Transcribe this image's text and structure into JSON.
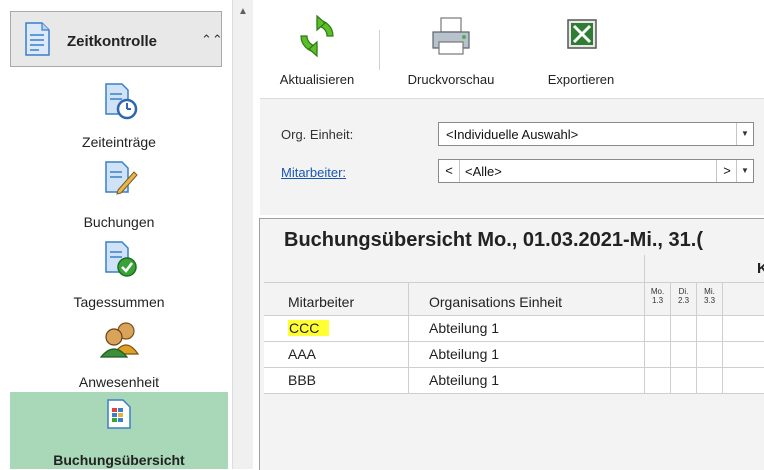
{
  "sidebar": {
    "header": {
      "title": "Zeitkontrolle",
      "collapse_icon": "double-chevron-up-icon"
    },
    "items": [
      {
        "label": "Zeiteinträge",
        "icon": "document-clock-icon"
      },
      {
        "label": "Buchungen",
        "icon": "document-pencil-icon"
      },
      {
        "label": "Tagessummen",
        "icon": "document-check-icon"
      },
      {
        "label": "Anwesenheit",
        "icon": "users-icon"
      },
      {
        "label": "Buchungsübersicht",
        "icon": "grid-report-icon",
        "active": true
      }
    ]
  },
  "toolbar": {
    "refresh_label": "Aktualisieren",
    "preview_label": "Druckvorschau",
    "export_label": "Exportieren"
  },
  "filter": {
    "org_label": "Org. Einheit:",
    "org_value": "<Individuelle Auswahl>",
    "employee_label": "Mitarbeiter:",
    "employee_prev": "<",
    "employee_value": "<Alle>",
    "employee_next": ">"
  },
  "grid": {
    "title": "Buchungsübersicht  Mo., 01.03.2021-Mi., 31.(",
    "group_label": "K",
    "columns": [
      "Mitarbeiter",
      "Organisations Einheit"
    ],
    "days": [
      {
        "name": "Mo.",
        "date": "1.3"
      },
      {
        "name": "Di.",
        "date": "2.3"
      },
      {
        "name": "Mi.",
        "date": "3.3"
      }
    ],
    "rows": [
      {
        "employee": "CCC",
        "unit": "Abteilung 1",
        "highlight": true
      },
      {
        "employee": "AAA",
        "unit": "Abteilung 1"
      },
      {
        "employee": "BBB",
        "unit": "Abteilung 1"
      }
    ]
  },
  "colors": {
    "active_nav": "#a8d8b8",
    "highlight": "#ffff33",
    "link": "#1a56b0"
  }
}
